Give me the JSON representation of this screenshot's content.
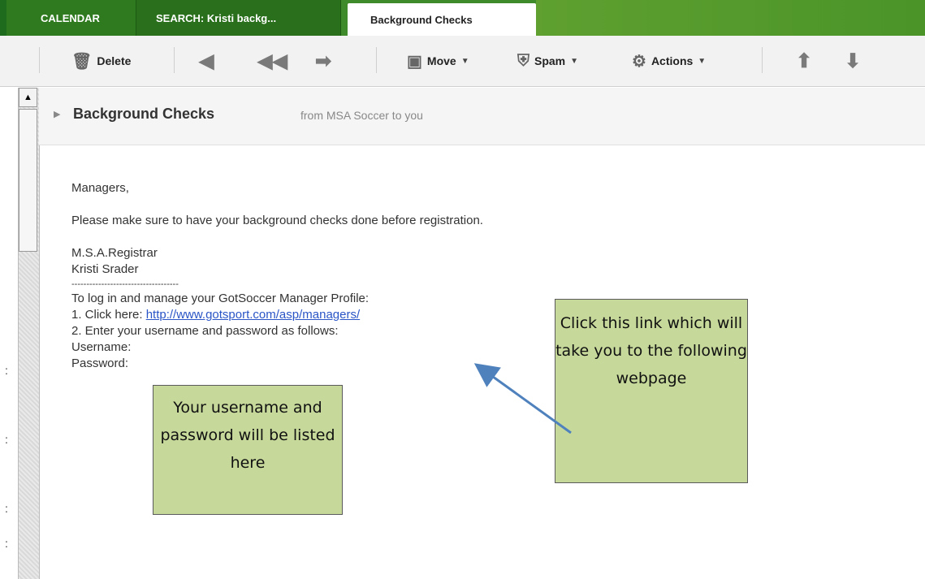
{
  "tabs": [
    {
      "label": "CALENDAR"
    },
    {
      "label": "SEARCH: Kristi backg..."
    },
    {
      "label": "Background Checks"
    }
  ],
  "toolbar": {
    "delete_label": "Delete",
    "move_label": "Move",
    "spam_label": "Spam",
    "actions_label": "Actions"
  },
  "message": {
    "subject": "Background Checks",
    "from_line": "from MSA Soccer to you",
    "lines": {
      "greeting": "Managers,",
      "body1": "Please make sure to have your background checks done before registration.",
      "sig1": "M.S.A.Registrar",
      "sig2": "Kristi Srader",
      "divider": "------------------------------------",
      "login_intro": "To log in and manage your GotSoccer Manager Profile:",
      "step1_prefix": "1. Click here: ",
      "step1_link": "http://www.gotsport.com/asp/managers/",
      "step2": "2. Enter your username and password as follows:",
      "username_label": "Username:",
      "password_label": "Password:"
    }
  },
  "callouts": {
    "credentials": "Your username and password will be listed here",
    "link": "Click this link which will take you to the following webpage"
  },
  "colors": {
    "tab_bar": "#3f8a2a",
    "callout_fill": "#c6d99a",
    "arrow": "#4f81bd",
    "link": "#2a55c6"
  }
}
